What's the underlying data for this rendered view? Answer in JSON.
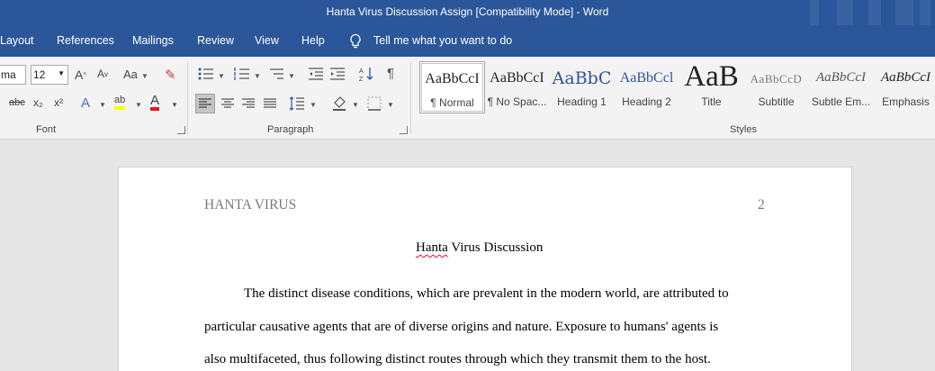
{
  "window": {
    "title": "Hanta Virus Discussion Assign [Compatibility Mode]  -  Word"
  },
  "tabs": [
    {
      "label": "Layout"
    },
    {
      "label": "References"
    },
    {
      "label": "Mailings"
    },
    {
      "label": "Review"
    },
    {
      "label": "View"
    },
    {
      "label": "Help"
    }
  ],
  "tell_me": "Tell me what you want to do",
  "font": {
    "name_value": "ma",
    "size_value": "12",
    "grow_label": "A",
    "shrink_label": "A",
    "case_label": "Aa",
    "strike_label": "abc",
    "subscript_label": "x₂",
    "superscript_label": "x²",
    "effects_label": "A",
    "highlight_label": "ab",
    "color_label": "A",
    "group_label": "Font"
  },
  "paragraph": {
    "group_label": "Paragraph",
    "pilcrow": "¶"
  },
  "styles": {
    "group_label": "Styles",
    "items": [
      {
        "preview": "AaBbCcI",
        "name": "¶ Normal"
      },
      {
        "preview": "AaBbCcI",
        "name": "¶ No Spac..."
      },
      {
        "preview": "AaBbC",
        "name": "Heading 1"
      },
      {
        "preview": "AaBbCcl",
        "name": "Heading 2"
      },
      {
        "preview": "AaB",
        "name": "Title"
      },
      {
        "preview": "AaBbCcD",
        "name": "Subtitle"
      },
      {
        "preview": "AaBbCcI",
        "name": "Subtle Em..."
      },
      {
        "preview": "AaBbCcI",
        "name": "Emphasis"
      }
    ]
  },
  "document": {
    "running_head": "HANTA VIRUS",
    "page_number": "2",
    "title_word1": "Hanta",
    "title_rest": " Virus Discussion",
    "lines": [
      "The distinct disease conditions, which are prevalent in the modern world, are attributed to",
      "particular causative agents that are of diverse origins and nature. Exposure to humans' agents is",
      "also multifaceted, thus following distinct routes through which they transmit them to the host."
    ]
  },
  "colors": {
    "accent": "#2b579a",
    "highlight": "#ffff00",
    "font_color": "#e81123"
  }
}
